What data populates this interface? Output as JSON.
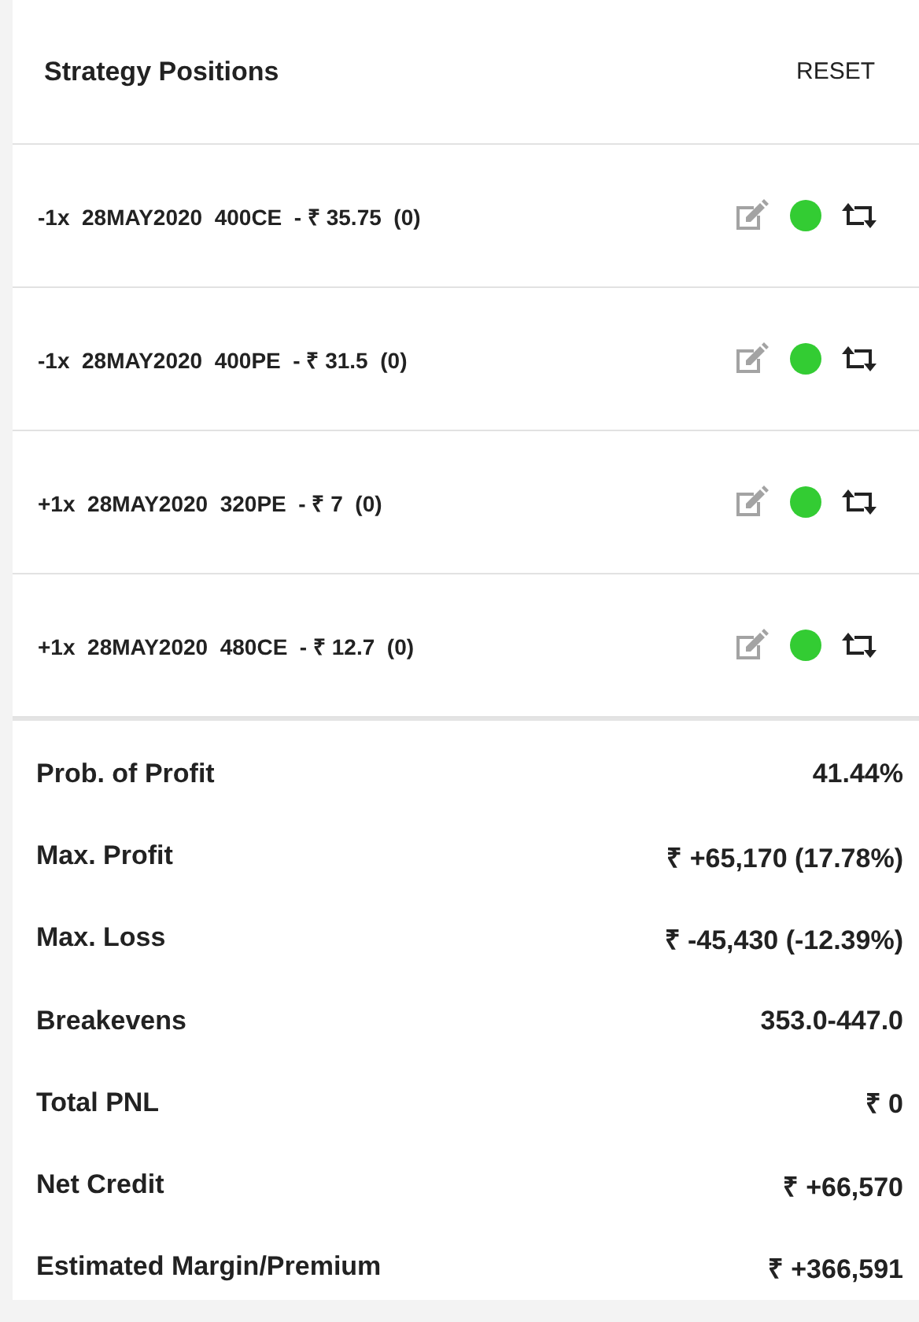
{
  "header": {
    "title": "Strategy Positions",
    "reset_button": "RESET"
  },
  "positions": [
    {
      "label": "-1x  28MAY2020  400CE  - ₹ 35.75  (0)",
      "color": "#33cc33"
    },
    {
      "label": "-1x  28MAY2020  400PE  - ₹ 31.5  (0)",
      "color": "#33cc33"
    },
    {
      "label": "+1x  28MAY2020  320PE  - ₹ 7  (0)",
      "color": "#33cc33"
    },
    {
      "label": "+1x  28MAY2020  480CE  - ₹ 12.7  (0)",
      "color": "#33cc33"
    }
  ],
  "stats": [
    {
      "label": "Prob. of Profit",
      "value": "41.44%"
    },
    {
      "label": "Max. Profit",
      "value": "₹ +65,170 (17.78%)"
    },
    {
      "label": "Max. Loss",
      "value": "₹ -45,430 (-12.39%)"
    },
    {
      "label": "Breakevens",
      "value": "353.0-447.0"
    },
    {
      "label": "Total PNL",
      "value": "₹ 0"
    },
    {
      "label": "Net Credit",
      "value": "₹ +66,570"
    },
    {
      "label": "Estimated Margin/Premium",
      "value": "₹ +366,591"
    }
  ]
}
